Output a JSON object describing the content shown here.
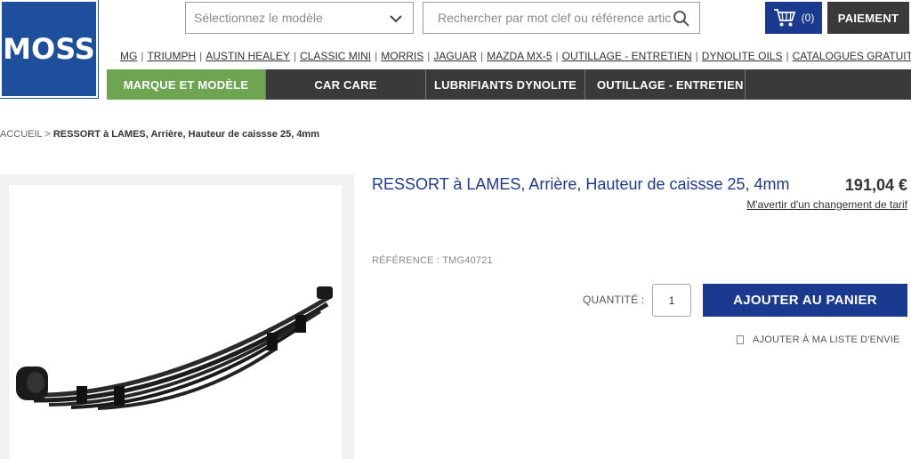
{
  "logo": {
    "text": "MOSS",
    "color": "#1e4f9c"
  },
  "header": {
    "model_select": {
      "placeholder": "Sélectionnez le modèle",
      "icon": "chevron-down-icon"
    },
    "search": {
      "placeholder": "Rechercher par mot clef ou référence article",
      "icon": "search-icon"
    },
    "cart": {
      "count": "(0)",
      "icon": "cart-icon"
    },
    "payment_label": "PAIEMENT"
  },
  "brand_links": [
    "MG",
    "TRIUMPH",
    "AUSTIN HEALEY",
    "CLASSIC MINI",
    "MORRIS",
    "JAGUAR",
    "MAZDA MX-5",
    "OUTILLAGE - ENTRETIEN",
    "DYNOLITE OILS",
    "CATALOGUES GRATUITS"
  ],
  "main_nav": [
    {
      "label": "MARQUE ET MODÈLE",
      "active": true
    },
    {
      "label": "CAR CARE",
      "active": false
    },
    {
      "label": "LUBRIFIANTS DYNOLITE",
      "active": false
    },
    {
      "label": "OUTILLAGE - ENTRETIEN",
      "active": false
    }
  ],
  "breadcrumb": {
    "home": "ACCUEIL",
    "separator": ">",
    "current": "RESSORT à LAMES, Arrière, Hauteur de caissse 25, 4mm"
  },
  "product": {
    "title": "RESSORT à LAMES, Arrière, Hauteur de caissse 25, 4mm",
    "price": "191,04 €",
    "price_alert_link": "M'avertir d'un changement de tarif",
    "reference": "RÉFÉRENCE : TMG40721",
    "quantity_label": "QUANTITÉ :",
    "quantity_value": "1",
    "add_to_cart_label": "AJOUTER AU PANIER",
    "wishlist_label": "AJOUTER À MA LISTE D'ENVIE"
  },
  "colors": {
    "nav_dark": "#3a3a3a",
    "nav_active": "#6da551",
    "primary_blue": "#1a3a8f",
    "title_blue": "#1e3a8a"
  }
}
